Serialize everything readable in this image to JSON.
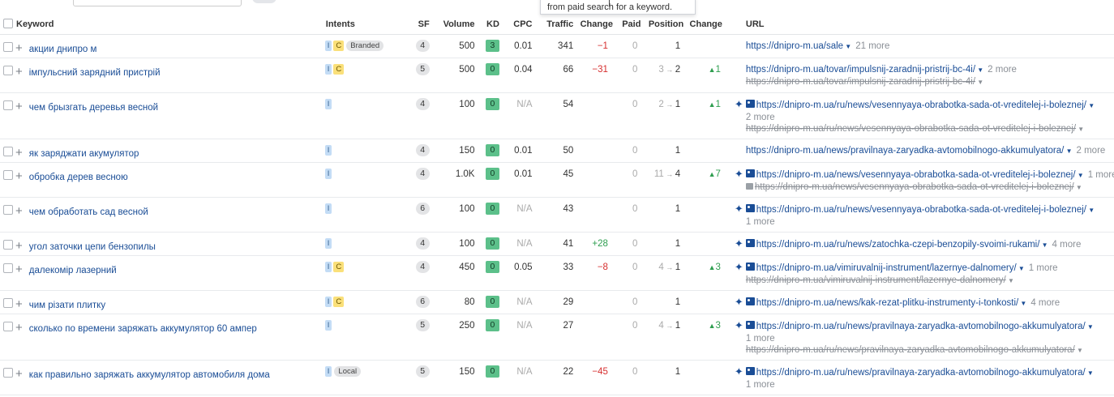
{
  "tooltip": "from paid search for a keyword.",
  "columns": {
    "keyword": "Keyword",
    "intents": "Intents",
    "sf": "SF",
    "volume": "Volume",
    "kd": "KD",
    "cpc": "CPC",
    "traffic": "Traffic",
    "change": "Change",
    "paid": "Paid",
    "position": "Position",
    "pos_change": "Change",
    "url": "URL"
  },
  "rows": [
    {
      "keyword": "акции днипро м",
      "intents": [
        "I",
        "C"
      ],
      "tag": "Branded",
      "sf": "4",
      "volume": "500",
      "kd": "3",
      "cpc": "0.01",
      "traffic": "341",
      "change": "−1",
      "change_type": "neg",
      "paid": "0",
      "pos_prev": "",
      "pos": "1",
      "pos_change": "",
      "url": "https://dnipro-m.ua/sale",
      "url_icons": false,
      "url_more": "21 more",
      "url_more_newline": false,
      "old_url": "",
      "old_icon": false,
      "old_more": ""
    },
    {
      "keyword": "імпульсний зарядний пристрій",
      "intents": [
        "I",
        "C"
      ],
      "tag": "",
      "sf": "5",
      "volume": "500",
      "kd": "0",
      "cpc": "0.04",
      "traffic": "66",
      "change": "−31",
      "change_type": "neg",
      "paid": "0",
      "pos_prev": "3",
      "pos": "2",
      "pos_change": "1",
      "url": "https://dnipro-m.ua/tovar/impulsnij-zaradnij-pristrij-bc-4i/",
      "url_icons": false,
      "url_more": "2 more",
      "url_more_newline": false,
      "old_url": "https://dnipro-m.ua/tovar/impulsnij-zaradnij-pristrij-bc-4i/",
      "old_icon": false,
      "old_more": ""
    },
    {
      "keyword": "чем брызгать деревья весной",
      "intents": [
        "I"
      ],
      "tag": "",
      "sf": "4",
      "volume": "100",
      "kd": "0",
      "cpc": "N/A",
      "traffic": "54",
      "change": "",
      "change_type": "",
      "paid": "0",
      "pos_prev": "2",
      "pos": "1",
      "pos_change": "1",
      "url": "https://dnipro-m.ua/ru/news/vesennyaya-obrabotka-sada-ot-vreditelej-i-boleznej/",
      "url_icons": true,
      "url_more": "2 more",
      "url_more_newline": true,
      "old_url": "https://dnipro-m.ua/ru/news/vesennyaya-obrabotka-sada-ot-vreditelej-i-boleznej/",
      "old_icon": false,
      "old_more": ""
    },
    {
      "keyword": "як заряджати акумулятор",
      "intents": [
        "I"
      ],
      "tag": "",
      "sf": "4",
      "volume": "150",
      "kd": "0",
      "cpc": "0.01",
      "traffic": "50",
      "change": "",
      "change_type": "",
      "paid": "0",
      "pos_prev": "",
      "pos": "1",
      "pos_change": "",
      "url": "https://dnipro-m.ua/news/pravilnaya-zaryadka-avtomobilnogo-akkumulyatora/",
      "url_icons": false,
      "url_more": "2 more",
      "url_more_newline": false,
      "old_url": "",
      "old_icon": false,
      "old_more": ""
    },
    {
      "keyword": "обробка дерев весною",
      "intents": [
        "I"
      ],
      "tag": "",
      "sf": "4",
      "volume": "1.0K",
      "kd": "0",
      "cpc": "0.01",
      "traffic": "45",
      "change": "",
      "change_type": "",
      "paid": "0",
      "pos_prev": "11",
      "pos": "4",
      "pos_change": "7",
      "url": "https://dnipro-m.ua/news/vesennyaya-obrabotka-sada-ot-vreditelej-i-boleznej/",
      "url_icons": true,
      "url_more": "1 more",
      "url_more_newline": false,
      "old_url": "https://dnipro-m.ua/news/vesennyaya-obrabotka-sada-ot-vreditelej-i-boleznej/",
      "old_icon": true,
      "old_more": ""
    },
    {
      "keyword": "чем обработать сад весной",
      "intents": [
        "I"
      ],
      "tag": "",
      "sf": "6",
      "volume": "100",
      "kd": "0",
      "cpc": "N/A",
      "traffic": "43",
      "change": "",
      "change_type": "",
      "paid": "0",
      "pos_prev": "",
      "pos": "1",
      "pos_change": "",
      "url": "https://dnipro-m.ua/ru/news/vesennyaya-obrabotka-sada-ot-vreditelej-i-boleznej/",
      "url_icons": true,
      "url_more": "1 more",
      "url_more_newline": true,
      "old_url": "",
      "old_icon": false,
      "old_more": ""
    },
    {
      "keyword": "угол заточки цепи бензопилы",
      "intents": [
        "I"
      ],
      "tag": "",
      "sf": "4",
      "volume": "100",
      "kd": "0",
      "cpc": "N/A",
      "traffic": "41",
      "change": "+28",
      "change_type": "pos",
      "paid": "0",
      "pos_prev": "",
      "pos": "1",
      "pos_change": "",
      "url": "https://dnipro-m.ua/ru/news/zatochka-czepi-benzopily-svoimi-rukami/",
      "url_icons": true,
      "url_more": "4 more",
      "url_more_newline": false,
      "old_url": "",
      "old_icon": false,
      "old_more": ""
    },
    {
      "keyword": "далекомір лазерний",
      "intents": [
        "I",
        "C"
      ],
      "tag": "",
      "sf": "4",
      "volume": "450",
      "kd": "0",
      "cpc": "0.05",
      "traffic": "33",
      "change": "−8",
      "change_type": "neg",
      "paid": "0",
      "pos_prev": "4",
      "pos": "1",
      "pos_change": "3",
      "url": "https://dnipro-m.ua/vimiruvalnij-instrument/lazernye-dalnomery/",
      "url_icons": true,
      "url_more": "1 more",
      "url_more_newline": false,
      "old_url": "https://dnipro-m.ua/vimiruvalnij-instrument/lazernye-dalnomery/",
      "old_icon": false,
      "old_more": ""
    },
    {
      "keyword": "чим різати плитку",
      "intents": [
        "I",
        "C"
      ],
      "tag": "",
      "sf": "6",
      "volume": "80",
      "kd": "0",
      "cpc": "N/A",
      "traffic": "29",
      "change": "",
      "change_type": "",
      "paid": "0",
      "pos_prev": "",
      "pos": "1",
      "pos_change": "",
      "url": "https://dnipro-m.ua/news/kak-rezat-plitku-instrumenty-i-tonkosti/",
      "url_icons": true,
      "url_more": "4 more",
      "url_more_newline": false,
      "old_url": "",
      "old_icon": false,
      "old_more": ""
    },
    {
      "keyword": "сколько по времени заряжать аккумулятор 60 ампер",
      "intents": [
        "I"
      ],
      "tag": "",
      "sf": "5",
      "volume": "250",
      "kd": "0",
      "cpc": "N/A",
      "traffic": "27",
      "change": "",
      "change_type": "",
      "paid": "0",
      "pos_prev": "4",
      "pos": "1",
      "pos_change": "3",
      "url": "https://dnipro-m.ua/ru/news/pravilnaya-zaryadka-avtomobilnogo-akkumulyatora/",
      "url_icons": true,
      "url_more": "1 more",
      "url_more_newline": true,
      "old_url": "https://dnipro-m.ua/ru/news/pravilnaya-zaryadka-avtomobilnogo-akkumulyatora/",
      "old_icon": false,
      "old_more": ""
    },
    {
      "keyword": "как правильно заряжать аккумулятор автомобиля дома",
      "intents": [
        "I"
      ],
      "tag": "Local",
      "sf": "5",
      "volume": "150",
      "kd": "0",
      "cpc": "N/A",
      "traffic": "22",
      "change": "−45",
      "change_type": "neg",
      "paid": "0",
      "pos_prev": "",
      "pos": "1",
      "pos_change": "",
      "url": "https://dnipro-m.ua/ru/news/pravilnaya-zaryadka-avtomobilnogo-akkumulyatora/",
      "url_icons": true,
      "url_more": "1 more",
      "url_more_newline": true,
      "old_url": "",
      "old_icon": false,
      "old_more": ""
    }
  ],
  "colors": {
    "link": "#1a4d96",
    "kd_green": "#5cc08a",
    "intent_I": "#c3dcf5",
    "intent_C": "#fae07a",
    "negative": "#d62f2f",
    "positive": "#2f9e50"
  }
}
